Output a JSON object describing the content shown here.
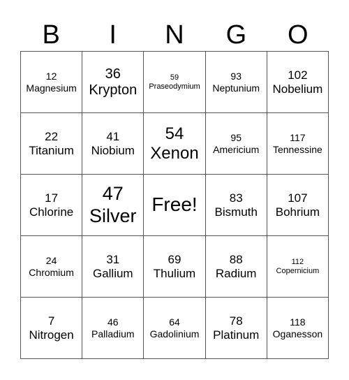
{
  "header": [
    "B",
    "I",
    "N",
    "G",
    "O"
  ],
  "cells": [
    {
      "number": "12",
      "name": "Magnesium",
      "size": "s-s"
    },
    {
      "number": "36",
      "name": "Krypton",
      "size": "s-l"
    },
    {
      "number": "59",
      "name": "Praseodymium",
      "size": "s-xs"
    },
    {
      "number": "93",
      "name": "Neptunium",
      "size": "s-s"
    },
    {
      "number": "102",
      "name": "Nobelium",
      "size": "s-m"
    },
    {
      "number": "22",
      "name": "Titanium",
      "size": "s-m"
    },
    {
      "number": "41",
      "name": "Niobium",
      "size": "s-m"
    },
    {
      "number": "54",
      "name": "Xenon",
      "size": "s-xl"
    },
    {
      "number": "95",
      "name": "Americium",
      "size": "s-s"
    },
    {
      "number": "117",
      "name": "Tennessine",
      "size": "s-s"
    },
    {
      "number": "17",
      "name": "Chlorine",
      "size": "s-m"
    },
    {
      "number": "47",
      "name": "Silver",
      "size": "s-xxl"
    },
    {
      "free": true,
      "label": "Free!"
    },
    {
      "number": "83",
      "name": "Bismuth",
      "size": "s-m"
    },
    {
      "number": "107",
      "name": "Bohrium",
      "size": "s-m"
    },
    {
      "number": "24",
      "name": "Chromium",
      "size": "s-s"
    },
    {
      "number": "31",
      "name": "Gallium",
      "size": "s-m"
    },
    {
      "number": "69",
      "name": "Thulium",
      "size": "s-m"
    },
    {
      "number": "88",
      "name": "Radium",
      "size": "s-m"
    },
    {
      "number": "112",
      "name": "Copernicium",
      "size": "s-xs"
    },
    {
      "number": "7",
      "name": "Nitrogen",
      "size": "s-m"
    },
    {
      "number": "46",
      "name": "Palladium",
      "size": "s-s"
    },
    {
      "number": "64",
      "name": "Gadolinium",
      "size": "s-s"
    },
    {
      "number": "78",
      "name": "Platinum",
      "size": "s-m"
    },
    {
      "number": "118",
      "name": "Oganesson",
      "size": "s-s"
    }
  ]
}
